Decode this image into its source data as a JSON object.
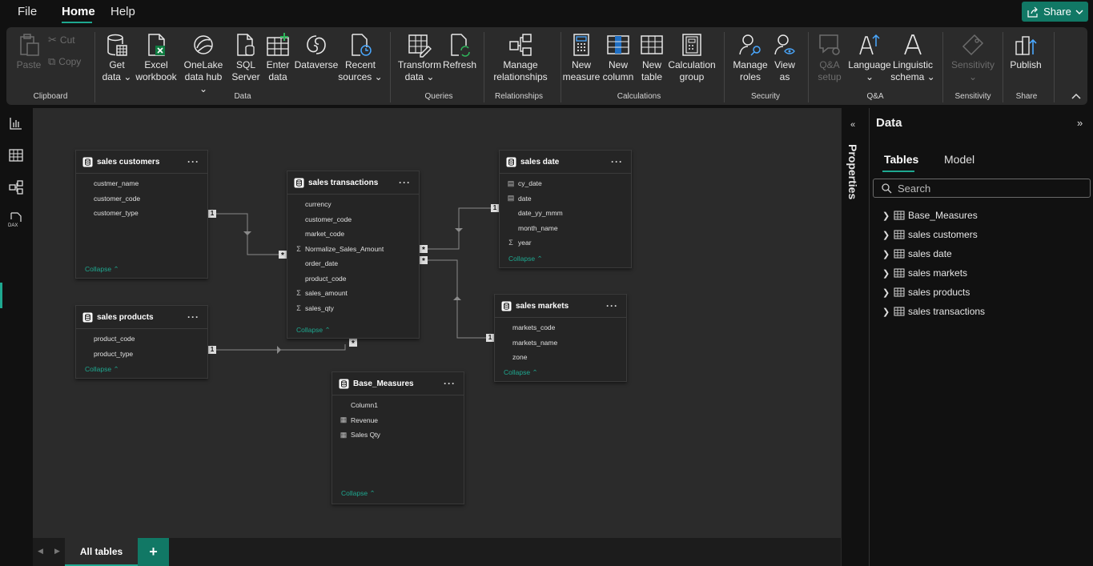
{
  "menu": {
    "file": "File",
    "home": "Home",
    "help": "Help",
    "share": "Share"
  },
  "ribbon": {
    "clipboard": {
      "paste": "Paste",
      "cut": "Cut",
      "copy": "Copy",
      "label": "Clipboard"
    },
    "data": {
      "get_data": [
        "Get",
        "data"
      ],
      "excel": [
        "Excel",
        "workbook"
      ],
      "onelake": [
        "OneLake",
        "data hub"
      ],
      "sql": [
        "SQL",
        "Server"
      ],
      "enter": [
        "Enter",
        "data"
      ],
      "dataverse": [
        "Dataverse",
        ""
      ],
      "recent": [
        "Recent",
        "sources"
      ],
      "label": "Data"
    },
    "queries": {
      "transform": [
        "Transform",
        "data"
      ],
      "refresh": [
        "Refresh",
        ""
      ],
      "label": "Queries"
    },
    "relationships": {
      "manage": [
        "Manage",
        "relationships"
      ],
      "label": "Relationships"
    },
    "calculations": {
      "new_measure": [
        "New",
        "measure"
      ],
      "new_column": [
        "New",
        "column"
      ],
      "new_table": [
        "New",
        "table"
      ],
      "calc_group": [
        "Calculation",
        "group"
      ],
      "label": "Calculations"
    },
    "security": {
      "manage_roles": [
        "Manage",
        "roles"
      ],
      "view_as": [
        "View",
        "as"
      ],
      "label": "Security"
    },
    "qa": {
      "setup": [
        "Q&A",
        "setup"
      ],
      "language": [
        "Language",
        ""
      ],
      "linguistic": [
        "Linguistic",
        "schema"
      ],
      "label": "Q&A"
    },
    "sensitivity": {
      "btn": [
        "Sensitivity",
        ""
      ],
      "label": "Sensitivity"
    },
    "share": {
      "publish": [
        "Publish",
        ""
      ],
      "label": "Share"
    }
  },
  "cards": {
    "customers": {
      "title": "sales customers",
      "fields": [
        "custmer_name",
        "customer_code",
        "customer_type"
      ],
      "collapse": "Collapse"
    },
    "transactions": {
      "title": "sales transactions",
      "fields": [
        "currency",
        "customer_code",
        "market_code",
        "Normalize_Sales_Amount",
        "order_date",
        "product_code",
        "sales_amount",
        "sales_qty"
      ],
      "collapse": "Collapse"
    },
    "date": {
      "title": "sales date",
      "fields": [
        "cy_date",
        "date",
        "date_yy_mmm",
        "month_name",
        "year"
      ],
      "collapse": "Collapse"
    },
    "products": {
      "title": "sales products",
      "fields": [
        "product_code",
        "product_type"
      ],
      "collapse": "Collapse"
    },
    "markets": {
      "title": "sales markets",
      "fields": [
        "markets_code",
        "markets_name",
        "zone"
      ],
      "collapse": "Collapse"
    },
    "base": {
      "title": "Base_Measures",
      "fields": [
        "Column1",
        "Revenue",
        "Sales Qty"
      ],
      "collapse": "Collapse"
    }
  },
  "rel": {
    "one": "1",
    "many": "*"
  },
  "bottom": {
    "tab": "All tables",
    "add": "+"
  },
  "properties": {
    "label": "Properties"
  },
  "datapane": {
    "title": "Data",
    "tabs": [
      "Tables",
      "Model"
    ],
    "search_placeholder": "Search",
    "tables": [
      "Base_Measures",
      "sales customers",
      "sales date",
      "sales markets",
      "sales products",
      "sales transactions"
    ]
  }
}
